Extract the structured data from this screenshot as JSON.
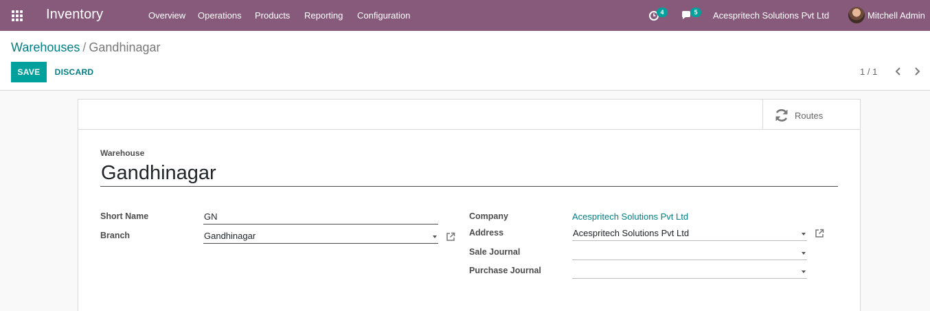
{
  "navbar": {
    "app_name": "Inventory",
    "menus": [
      "Overview",
      "Operations",
      "Products",
      "Reporting",
      "Configuration"
    ],
    "activity_count": "4",
    "message_count": "5",
    "company": "Acespritech Solutions Pvt Ltd",
    "user": "Mitchell Admin"
  },
  "breadcrumb": {
    "parent": "Warehouses",
    "separator": "/",
    "current": "Gandhinagar"
  },
  "actions": {
    "save_label": "SAVE",
    "discard_label": "DISCARD"
  },
  "pager": {
    "value": "1 / 1"
  },
  "smart_buttons": {
    "routes_label": "Routes"
  },
  "form": {
    "title_label": "Warehouse",
    "name": "Gandhinagar",
    "left": {
      "short_name_label": "Short Name",
      "short_name_value": "GN",
      "branch_label": "Branch",
      "branch_value": "Gandhinagar"
    },
    "right": {
      "company_label": "Company",
      "company_value": "Acespritech Solutions Pvt Ltd",
      "address_label": "Address",
      "address_value": "Acespritech Solutions Pvt Ltd",
      "sale_journal_label": "Sale Journal",
      "sale_journal_value": "",
      "purchase_journal_label": "Purchase Journal",
      "purchase_journal_value": ""
    }
  },
  "colors": {
    "navbar": "#875a7b",
    "primary": "#00a09d",
    "link": "#017e84"
  },
  "icons": [
    "apps-grid-icon",
    "activity-clock-icon",
    "chat-icon",
    "chevron-left-icon",
    "chevron-right-icon",
    "refresh-icon",
    "external-link-icon",
    "dropdown-caret-icon"
  ]
}
